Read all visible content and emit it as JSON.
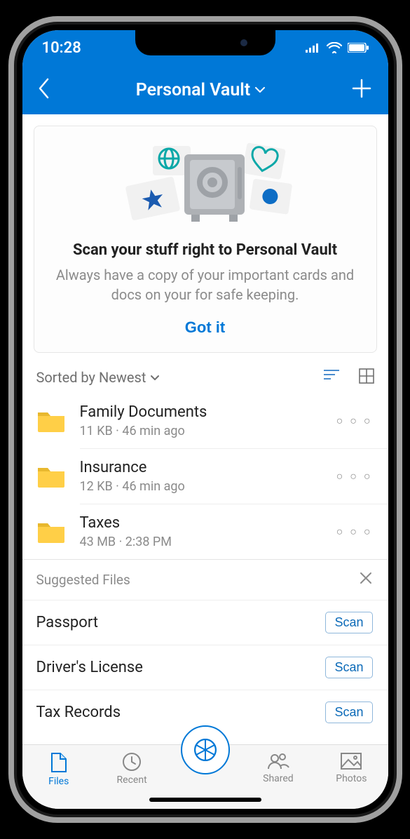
{
  "status": {
    "time": "10:28"
  },
  "header": {
    "title": "Personal Vault"
  },
  "promo": {
    "title": "Scan your stuff right to Personal Vault",
    "subtitle": "Always have a copy of your important cards and docs on your for safe keeping.",
    "button": "Got it"
  },
  "sort": {
    "label": "Sorted by Newest"
  },
  "files": [
    {
      "name": "Family Documents",
      "meta": "11 KB · 46 min ago"
    },
    {
      "name": "Insurance",
      "meta": "12 KB · 46 min ago"
    },
    {
      "name": "Taxes",
      "meta": "43 MB · 2:38 PM"
    }
  ],
  "suggested": {
    "header": "Suggested Files",
    "scan_label": "Scan",
    "items": [
      {
        "name": "Passport"
      },
      {
        "name": "Driver's License"
      },
      {
        "name": "Tax Records"
      }
    ]
  },
  "tabs": {
    "files": "Files",
    "recent": "Recent",
    "shared": "Shared",
    "photos": "Photos"
  }
}
